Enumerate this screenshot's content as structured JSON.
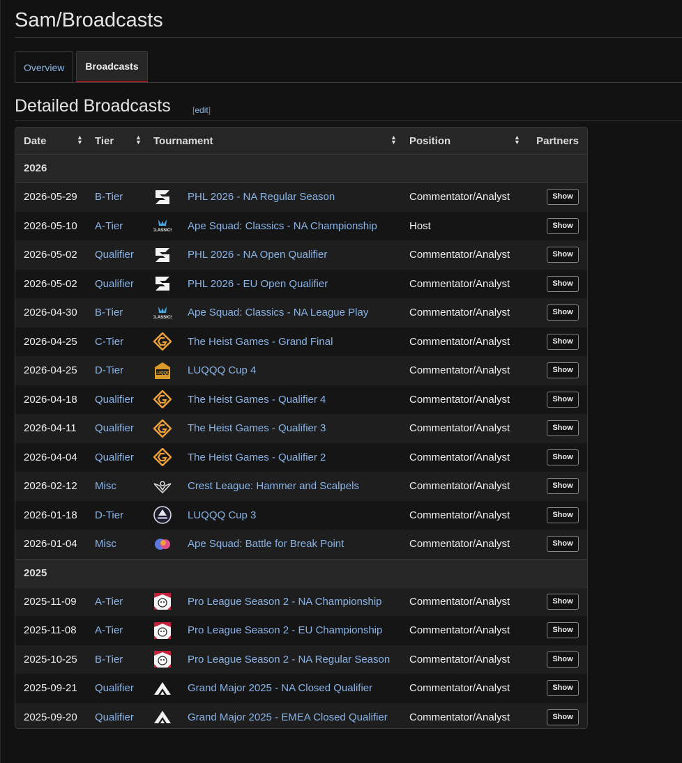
{
  "page": {
    "title": "Sam/Broadcasts"
  },
  "tabs": [
    {
      "label": "Overview",
      "active": false
    },
    {
      "label": "Broadcasts",
      "active": true
    }
  ],
  "section": {
    "title": "Detailed Broadcasts",
    "edit_open": "[",
    "edit_label": "edit",
    "edit_close": "]"
  },
  "table": {
    "headers": {
      "date": "Date",
      "tier": "Tier",
      "tournament": "Tournament",
      "position": "Position",
      "partners": "Partners"
    },
    "show_label": "Show",
    "groups": [
      {
        "year": "2026",
        "rows": [
          {
            "date": "2026-05-29",
            "tier": "B-Tier",
            "logo": "phl-icon",
            "tournament": "PHL 2026 - NA Regular Season",
            "position": "Commentator/Analyst"
          },
          {
            "date": "2026-05-10",
            "tier": "A-Tier",
            "logo": "ape-squad-classics-icon",
            "tournament": "Ape Squad: Classics - NA Championship",
            "position": "Host"
          },
          {
            "date": "2026-05-02",
            "tier": "Qualifier",
            "logo": "phl-icon",
            "tournament": "PHL 2026 - NA Open Qualifier",
            "position": "Commentator/Analyst"
          },
          {
            "date": "2026-05-02",
            "tier": "Qualifier",
            "logo": "phl-icon",
            "tournament": "PHL 2026 - EU Open Qualifier",
            "position": "Commentator/Analyst"
          },
          {
            "date": "2026-04-30",
            "tier": "B-Tier",
            "logo": "ape-squad-classics-icon",
            "tournament": "Ape Squad: Classics - NA League Play",
            "position": "Commentator/Analyst"
          },
          {
            "date": "2026-04-25",
            "tier": "C-Tier",
            "logo": "heist-games-icon",
            "tournament": "The Heist Games - Grand Final",
            "position": "Commentator/Analyst"
          },
          {
            "date": "2026-04-25",
            "tier": "D-Tier",
            "logo": "luqqq-cup-icon",
            "tournament": "LUQQQ Cup 4",
            "position": "Commentator/Analyst"
          },
          {
            "date": "2026-04-18",
            "tier": "Qualifier",
            "logo": "heist-games-icon",
            "tournament": "The Heist Games - Qualifier 4",
            "position": "Commentator/Analyst"
          },
          {
            "date": "2026-04-11",
            "tier": "Qualifier",
            "logo": "heist-games-icon",
            "tournament": "The Heist Games - Qualifier 3",
            "position": "Commentator/Analyst"
          },
          {
            "date": "2026-04-04",
            "tier": "Qualifier",
            "logo": "heist-games-icon",
            "tournament": "The Heist Games - Qualifier 2",
            "position": "Commentator/Analyst"
          },
          {
            "date": "2026-02-12",
            "tier": "Misc",
            "logo": "crest-league-icon",
            "tournament": "Crest League: Hammer and Scalpels",
            "position": "Commentator/Analyst"
          },
          {
            "date": "2026-01-18",
            "tier": "D-Tier",
            "logo": "luqqq-cup-3-icon",
            "tournament": "LUQQQ Cup 3",
            "position": "Commentator/Analyst"
          },
          {
            "date": "2026-01-04",
            "tier": "Misc",
            "logo": "ape-squad-break-point-icon",
            "tournament": "Ape Squad: Battle for Break Point",
            "position": "Commentator/Analyst"
          }
        ]
      },
      {
        "year": "2025",
        "rows": [
          {
            "date": "2025-11-09",
            "tier": "A-Tier",
            "logo": "pro-league-icon",
            "tournament": "Pro League Season 2 - NA Championship",
            "position": "Commentator/Analyst"
          },
          {
            "date": "2025-11-08",
            "tier": "A-Tier",
            "logo": "pro-league-icon",
            "tournament": "Pro League Season 2 - EU Championship",
            "position": "Commentator/Analyst"
          },
          {
            "date": "2025-10-25",
            "tier": "B-Tier",
            "logo": "pro-league-icon",
            "tournament": "Pro League Season 2 - NA Regular Season",
            "position": "Commentator/Analyst"
          },
          {
            "date": "2025-09-21",
            "tier": "Qualifier",
            "logo": "grand-major-icon",
            "tournament": "Grand Major 2025 - NA Closed Qualifier",
            "position": "Commentator/Analyst"
          },
          {
            "date": "2025-09-20",
            "tier": "Qualifier",
            "logo": "grand-major-icon",
            "tournament": "Grand Major 2025 - EMEA Closed Qualifier",
            "position": "Commentator/Analyst"
          }
        ]
      }
    ]
  },
  "colors": {
    "background": "#121212",
    "link": "#8ab4e8",
    "active_tab_accent": "#9a1c22",
    "heist_orange": "#f0a23a"
  }
}
